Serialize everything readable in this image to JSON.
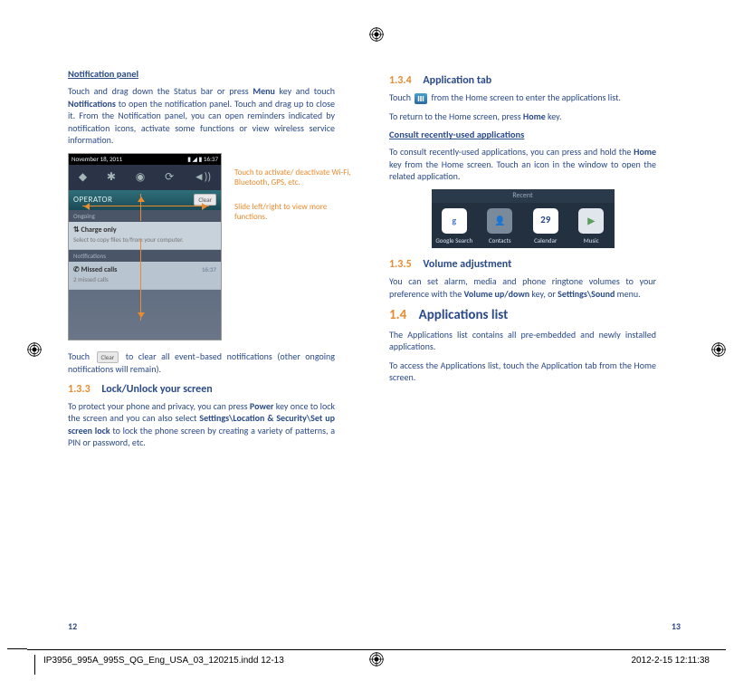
{
  "left": {
    "heading1": "Notification panel",
    "p1a": "Touch and drag down the Status bar or press ",
    "p1b": " key and touch ",
    "p1c": " to open the notification panel. Touch and drag up to close it. From the Notification panel, you can open reminders indicated by notification icons, activate some functions or view wireless service information.",
    "menu": "Menu",
    "notifications": "Notifications",
    "fig": {
      "date": "November 18, 2011",
      "time": "16:37",
      "operator": "OPERATOR",
      "clear": "Clear",
      "ongoing": "Ongoing",
      "chargeTitle": "Charge only",
      "chargeSub": "Select to copy files to/from your computer.",
      "notifsLabel": "Notifications",
      "missedTitle": "Missed calls",
      "missedSub": "2 missed calls",
      "missedTime": "16:37",
      "callout1": "Touch to activate/ deactivate Wi-Fi, Bluetooth, GPS, etc.",
      "callout2": "Slide left/right to view more functions."
    },
    "p2a": "Touch ",
    "p2b": " to clear all event–based notifications (other ongoing notifications will remain).",
    "sec133num": "1.3.3",
    "sec133title": "Lock/Unlock your screen",
    "p3a": "To protect your phone and privacy, you can press ",
    "power": "Power",
    "p3b": " key once to lock the screen and you can also select ",
    "settingsLoc": "Settings\\Location & Security\\Set up screen lock",
    "p3c": " to lock the phone screen by creating a variety of patterns, a PIN or password, etc.",
    "pageNum": "12"
  },
  "right": {
    "sec134num": "1.3.4",
    "sec134title": "Application tab",
    "p1a": "Touch ",
    "p1b": " from the Home screen to enter the applications list.",
    "p2a": "To return to the Home screen, press ",
    "home": "Home",
    "p2b": " key.",
    "consultHeading": "Consult recently-used applications",
    "p3a": "To consult recently-used applications, you can press and hold the ",
    "p3b": " key from the Home screen. Touch an icon in the window to open the related application.",
    "recent": {
      "title": "Recent",
      "items": [
        "Google Search",
        "Contacts",
        "Calendar",
        "Music"
      ],
      "calDay": "29"
    },
    "sec135num": "1.3.5",
    "sec135title": "Volume adjustment",
    "p4a": "You can set alarm, media and phone ringtone volumes to your preference with the ",
    "volKey": "Volume up/down",
    "p4b": " key, or ",
    "settingsSound": "Settings\\Sound",
    "p4c": " menu.",
    "sec14num": "1.4",
    "sec14title": "Applications list",
    "p5": "The Applications list contains all pre-embedded and newly installed applications.",
    "p6": "To access the Applications list, touch the Application tab from the Home screen.",
    "pageNum": "13"
  },
  "footer": {
    "left": "IP3956_995A_995S_QG_Eng_USA_03_120215.indd   12-13",
    "right": "2012-2-15   12:11:38"
  }
}
